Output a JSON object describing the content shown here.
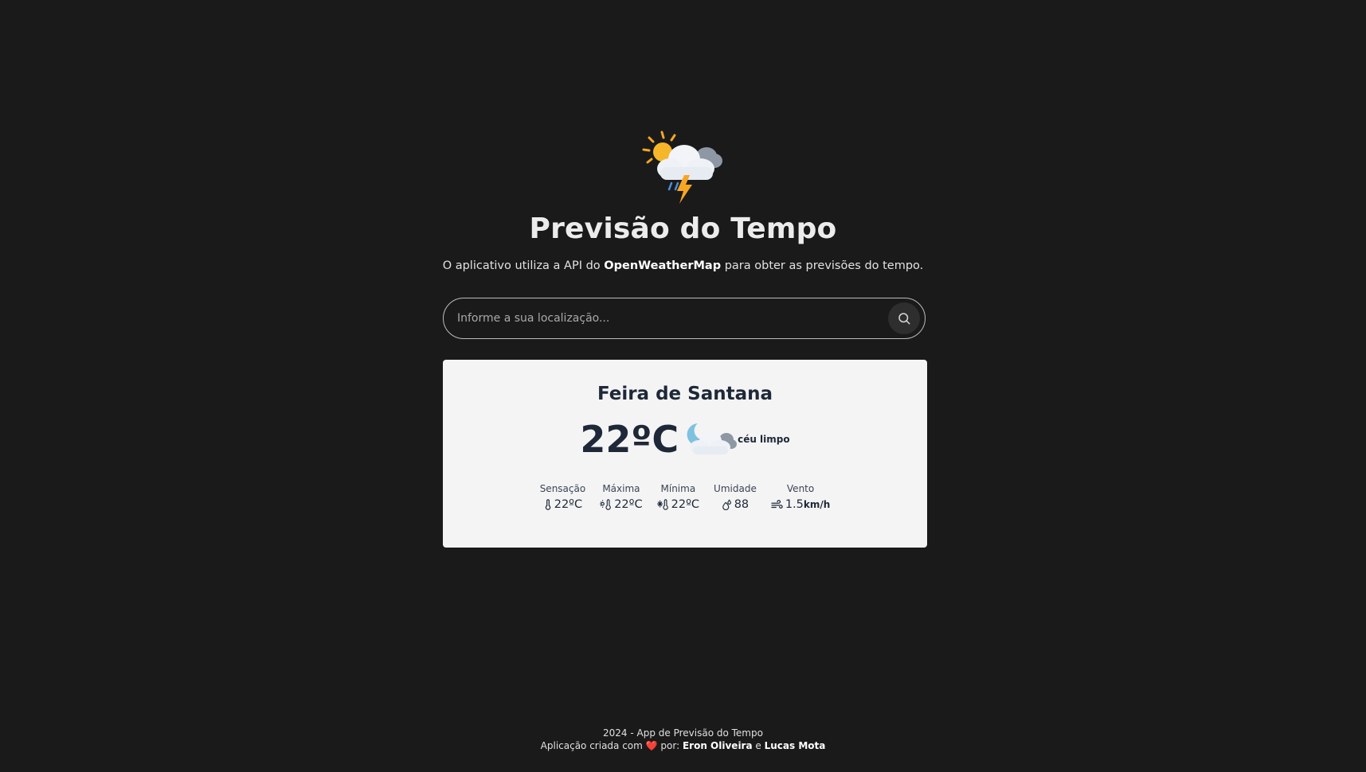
{
  "app": {
    "title": "Previsão do Tempo",
    "subtitle_prefix": "O aplicativo utiliza a API do ",
    "subtitle_brand": "OpenWeatherMap",
    "subtitle_suffix": " para obter as previsões do tempo.",
    "logo_icon": "storm-sun-cloud-icon"
  },
  "search": {
    "placeholder": "Informe a sua localização...",
    "value": "",
    "button_icon": "search-icon"
  },
  "weather": {
    "city": "Feira de Santana",
    "temperature": "22ºC",
    "condition": "céu limpo",
    "condition_icon": "night-cloudy-icon",
    "stats": [
      {
        "label": "Sensação",
        "value": "22ºC",
        "unit": "",
        "icon": "thermometer-icon"
      },
      {
        "label": "Máxima",
        "value": "22ºC",
        "unit": "",
        "icon": "thermometer-sun-icon"
      },
      {
        "label": "Mínima",
        "value": "22ºC",
        "unit": "",
        "icon": "thermometer-snow-icon"
      },
      {
        "label": "Umidade",
        "value": "88",
        "unit": "",
        "icon": "droplets-icon"
      },
      {
        "label": "Vento",
        "value": "1.5",
        "unit": "km/h",
        "icon": "wind-icon"
      }
    ]
  },
  "footer": {
    "line1": "2024 - App de Previsão do Tempo",
    "line2_prefix": "Aplicação criada com ",
    "heart": "❤️",
    "line2_by": " por: ",
    "author1": "Eron Oliveira",
    "conjunction": " e ",
    "author2": "Lucas Mota"
  },
  "colors": {
    "background": "#1a1a1a",
    "card": "#f4f4f4",
    "text_dark": "#1e2838",
    "accent_sun": "#f5a623"
  }
}
